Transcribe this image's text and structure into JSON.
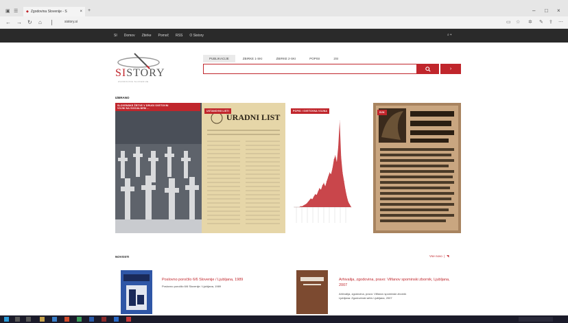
{
  "browser": {
    "tab_title": "Zgodovina Slovenije - S",
    "tab_close": "×",
    "new_tab": "+",
    "url": "sistory.si",
    "window_controls": [
      "–",
      "□",
      "×"
    ]
  },
  "site_nav": {
    "items": [
      "SI",
      "Domov",
      "Zbirke",
      "Pomoč",
      "RSS",
      "O Sistory"
    ],
    "right": "⌕  ▾"
  },
  "logo": {
    "brand_red": "SI",
    "brand_gray": "STORY",
    "tagline": "ZGODOVINA SLOVENIJE"
  },
  "search": {
    "tabs": [
      "PUBLIKACIJE",
      "ZBIRKE 1-SKI",
      "ZBIRKE 2-SKI",
      "POPISI",
      "2SI"
    ],
    "active_tab": 0,
    "button_icon": "search-icon",
    "menu_icon": "›"
  },
  "sections": {
    "featured": "IZBRANO",
    "latest": "NOVOSTI",
    "see_all": "Vse novo ❘ "
  },
  "cards": [
    {
      "badge_lines": [
        "SLOVENSKE ŽRTVE V DRUGI SVETOVNI",
        "VOJNI NA SOCIALNEM ..."
      ]
    },
    {
      "badge_lines": [
        "USTANOVNI LISTI"
      ],
      "paper_title": "URADNI LIST"
    },
    {
      "badge_lines": [
        "POPIS / SVETOVNA VOJNA"
      ]
    },
    {
      "badge_lines": [
        "SVK"
      ]
    }
  ],
  "publications": [
    {
      "title": "Poslovno poročilo 6/6 Slovenije / Ljubljana, 1989",
      "subtitle": "Poslovno poročilo 6/6 Slovenije / Ljubljana, 1989"
    },
    {
      "title": "Arhivalija, zgodovina, pravo: Vilfanov spominski zbornik, Ljubljana, 2007",
      "subtitle_lines": [
        "Arhivalija, zgodovina, pravo: Vilfanov spominski zbornik",
        "Ljubljana: Zgodovinski arhiv Ljubljana, 2007"
      ]
    }
  ],
  "colors": {
    "accent": "#c0262c",
    "nav_bg": "#2a2a2a",
    "taskbar_bg": "#1b1b2a"
  },
  "chart_data": {
    "type": "area",
    "title": "",
    "xlabel": "",
    "ylabel": "",
    "x": [
      1,
      2,
      3,
      4,
      5,
      6,
      7,
      8,
      9,
      10,
      11,
      12,
      13,
      14,
      15,
      16,
      17,
      18,
      19,
      20,
      21,
      22,
      23,
      24,
      25,
      26,
      27,
      28,
      29,
      30,
      31,
      32,
      33,
      34,
      35,
      36,
      37,
      38,
      39,
      40
    ],
    "values": [
      0,
      0,
      0,
      0,
      1,
      1,
      2,
      3,
      4,
      6,
      8,
      10,
      9,
      12,
      15,
      14,
      18,
      22,
      20,
      25,
      28,
      24,
      30,
      35,
      40,
      38,
      45,
      55,
      60,
      52,
      70,
      100,
      58,
      40,
      30,
      20,
      12,
      6,
      3,
      0
    ],
    "ylim": [
      0,
      100
    ],
    "grid": false,
    "color": "#c0262c"
  }
}
